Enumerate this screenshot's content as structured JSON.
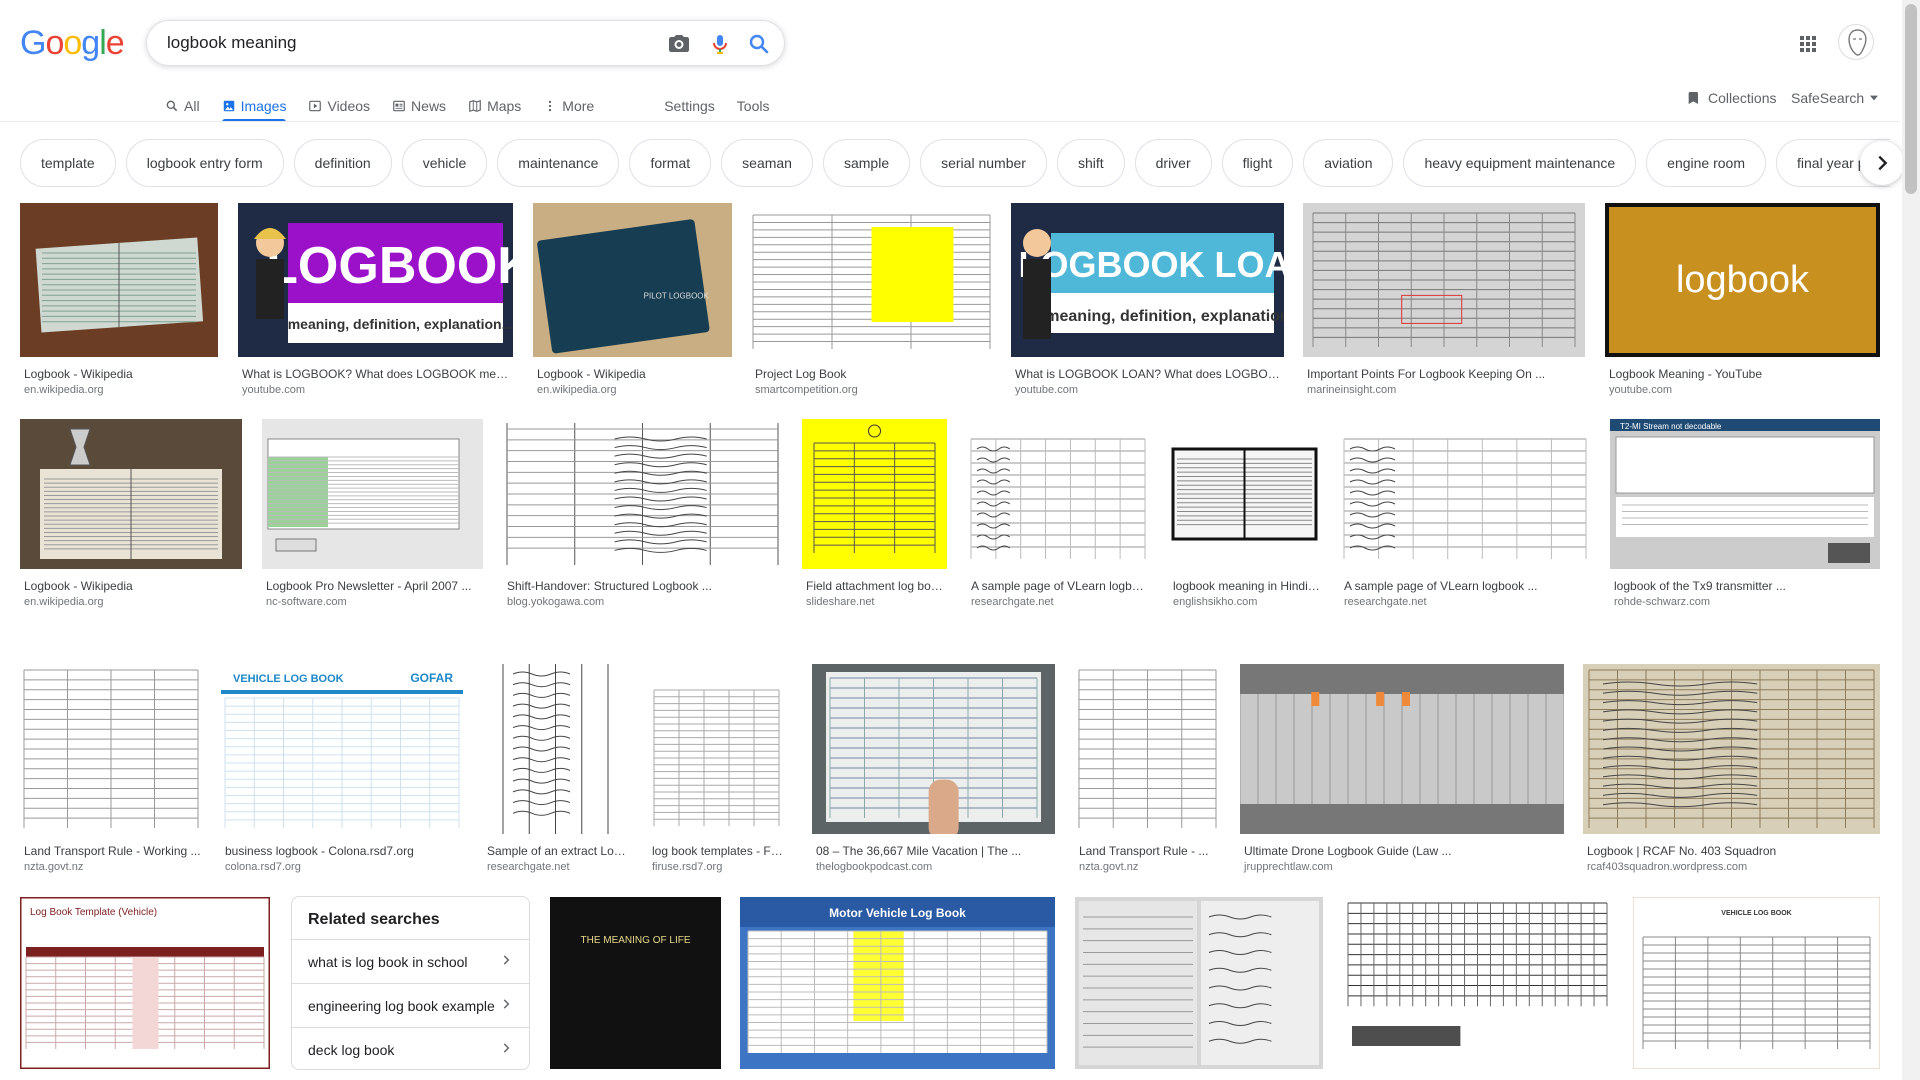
{
  "logo": {
    "letters": [
      {
        "ch": "G",
        "color": "#4285f4"
      },
      {
        "ch": "o",
        "color": "#ea4335"
      },
      {
        "ch": "o",
        "color": "#fbbc05"
      },
      {
        "ch": "g",
        "color": "#4285f4"
      },
      {
        "ch": "l",
        "color": "#34a853"
      },
      {
        "ch": "e",
        "color": "#ea4335"
      }
    ]
  },
  "search": {
    "query": "logbook meaning"
  },
  "nav": {
    "tabs": [
      {
        "label": "All",
        "icon": "search-icon",
        "active": false
      },
      {
        "label": "Images",
        "icon": "image-icon",
        "active": true
      },
      {
        "label": "Videos",
        "icon": "video-icon",
        "active": false
      },
      {
        "label": "News",
        "icon": "news-icon",
        "active": false
      },
      {
        "label": "Maps",
        "icon": "map-icon",
        "active": false
      },
      {
        "label": "More",
        "icon": "more-vert-icon",
        "active": false
      }
    ],
    "settings": "Settings",
    "tools": "Tools",
    "collections": "Collections",
    "safesearch": "SafeSearch"
  },
  "chips": [
    "template",
    "logbook entry form",
    "definition",
    "vehicle",
    "maintenance",
    "format",
    "seaman",
    "sample",
    "serial number",
    "shift",
    "driver",
    "flight",
    "aviation",
    "heavy equipment maintenance",
    "engine room",
    "final year project"
  ],
  "results": [
    {
      "title": "Logbook - Wikipedia",
      "source": "en.wikipedia.org"
    },
    {
      "title": "What is LOGBOOK? What does LOGBOOK mean ...",
      "source": "youtube.com",
      "overlay_title": "LOGBOOK",
      "overlay_sub": "meaning, definition, explanation..."
    },
    {
      "title": "Logbook - Wikipedia",
      "source": "en.wikipedia.org",
      "overlay_title": "PILOT LOGBOOK"
    },
    {
      "title": "Project Log Book",
      "source": "smartcompetition.org"
    },
    {
      "title": "What is LOGBOOK LOAN? What does LOGBOOK ...",
      "source": "youtube.com",
      "overlay_title": "LOGBOOK LOAN",
      "overlay_sub": "meaning, definition, explanation"
    },
    {
      "title": "Important Points For Logbook Keeping On ...",
      "source": "marineinsight.com"
    },
    {
      "title": "Logbook Meaning - YouTube",
      "source": "youtube.com",
      "overlay_title": "logbook"
    },
    {
      "title": "Logbook - Wikipedia",
      "source": "en.wikipedia.org"
    },
    {
      "title": "Logbook Pro Newsletter - April 2007 ...",
      "source": "nc-software.com"
    },
    {
      "title": "Shift-Handover: Structured Logbook ...",
      "source": "blog.yokogawa.com"
    },
    {
      "title": "Field attachment log book ...",
      "source": "slideshare.net"
    },
    {
      "title": "A sample page of VLearn logbook ...",
      "source": "researchgate.net"
    },
    {
      "title": "logbook meaning in Hindi ...",
      "source": "englishsikho.com"
    },
    {
      "title": "A sample page of VLearn logbook ...",
      "source": "researchgate.net"
    },
    {
      "title": "logbook of the Tx9 transmitter ...",
      "source": "rohde-schwarz.com",
      "overlay_title": "T2-MI Stream not decodable"
    },
    {
      "title": "Land Transport Rule - Working ...",
      "source": "nzta.govt.nz"
    },
    {
      "title": "business logbook - Colona.rsd7.org",
      "source": "colona.rsd7.org",
      "overlay_title": "VEHICLE LOG BOOK",
      "overlay_sub": "GOFAR"
    },
    {
      "title": "Sample of an extract Logbook ...",
      "source": "researchgate.net"
    },
    {
      "title": "log book templates - Free ...",
      "source": "firuse.rsd7.org"
    },
    {
      "title": "08 – The 36,667 Mile Vacation | The ...",
      "source": "thelogbookpodcast.com"
    },
    {
      "title": "Land Transport Rule - ...",
      "source": "nzta.govt.nz"
    },
    {
      "title": "Ultimate Drone Logbook Guide (Law ...",
      "source": "jrupprechtlaw.com"
    },
    {
      "title": "Logbook | RCAF No. 403 Squadron",
      "source": "rcaf403squadron.wordpress.com"
    },
    {
      "title": "",
      "source": "",
      "overlay_title": "Log Book Template (Vehicle)"
    },
    {
      "title": "",
      "source": "",
      "overlay_title": "THE MEANING OF LIFE"
    },
    {
      "title": "",
      "source": "",
      "overlay_title": "Motor Vehicle Log Book"
    },
    {
      "title": "",
      "source": ""
    },
    {
      "title": "",
      "source": ""
    },
    {
      "title": "",
      "source": "",
      "overlay_title": "VEHICLE LOG BOOK"
    }
  ],
  "related": {
    "heading": "Related searches",
    "items": [
      "what is log book in school",
      "engineering log book example",
      "deck log book"
    ]
  },
  "colors": {
    "accent": "#1a73e8"
  }
}
